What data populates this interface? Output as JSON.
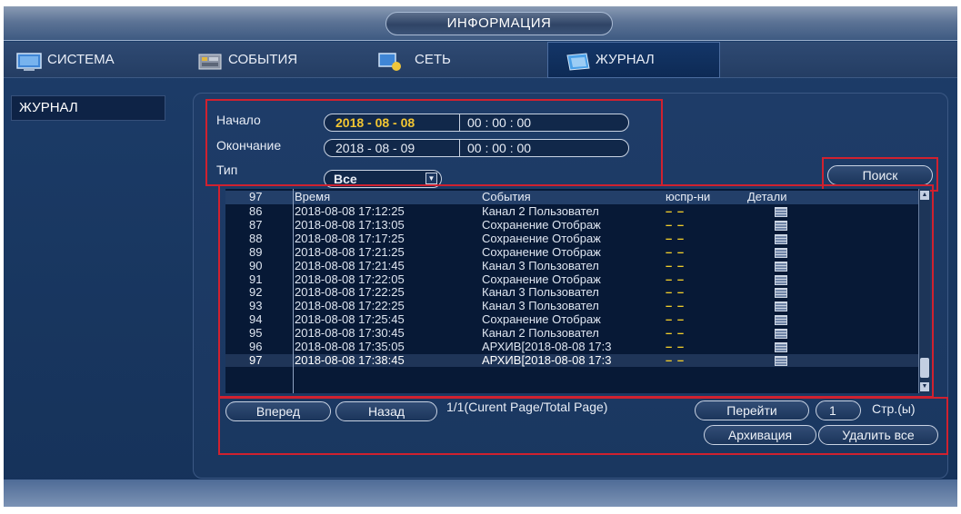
{
  "window": {
    "title": "ИНФОРМАЦИЯ"
  },
  "tabs": [
    {
      "label": "СИСТЕМА",
      "icon": "monitor-icon"
    },
    {
      "label": "СОБЫТИЯ",
      "icon": "events-icon"
    },
    {
      "label": "СЕТЬ",
      "icon": "network-icon"
    },
    {
      "label": "ЖУРНАЛ",
      "icon": "log-icon",
      "active": true
    }
  ],
  "sidebar": {
    "items": [
      {
        "label": "ЖУРНАЛ",
        "active": true
      }
    ]
  },
  "filters": {
    "start_label": "Начало",
    "start_date": "2018 - 08 - 08",
    "start_time": "00 : 00 : 00",
    "end_label": "Окончание",
    "end_date": "2018 - 08 - 09",
    "end_time": "00 : 00 : 00",
    "type_label": "Тип",
    "type_value": "Все",
    "search_label": "Поиск"
  },
  "table": {
    "columns": {
      "no": "97",
      "time": "Время",
      "event": "События",
      "playback": "юспр-ни",
      "details": "Детали"
    },
    "rows": [
      {
        "no": "86",
        "time": "2018-08-08 17:12:25",
        "event": "Канал 2 Пользовател",
        "playback": "– –"
      },
      {
        "no": "87",
        "time": "2018-08-08 17:13:05",
        "event": "Сохранение Отображ",
        "playback": "– –"
      },
      {
        "no": "88",
        "time": "2018-08-08 17:17:25",
        "event": "Сохранение Отображ",
        "playback": "– –"
      },
      {
        "no": "89",
        "time": "2018-08-08 17:21:25",
        "event": "Сохранение Отображ",
        "playback": "– –"
      },
      {
        "no": "90",
        "time": "2018-08-08 17:21:45",
        "event": "Канал 3 Пользовател",
        "playback": "– –"
      },
      {
        "no": "91",
        "time": "2018-08-08 17:22:05",
        "event": "Сохранение Отображ",
        "playback": "– –"
      },
      {
        "no": "92",
        "time": "2018-08-08 17:22:25",
        "event": "Канал 3 Пользовател",
        "playback": "– –"
      },
      {
        "no": "93",
        "time": "2018-08-08 17:22:25",
        "event": "Канал 3 Пользовател",
        "playback": "– –"
      },
      {
        "no": "94",
        "time": "2018-08-08 17:25:45",
        "event": "Сохранение Отображ",
        "playback": "– –"
      },
      {
        "no": "95",
        "time": "2018-08-08 17:30:45",
        "event": "Канал 2 Пользовател",
        "playback": "– –"
      },
      {
        "no": "96",
        "time": "2018-08-08 17:35:05",
        "event": "АРХИВ[2018-08-08 17:3",
        "playback": "– –"
      },
      {
        "no": "97",
        "time": "2018-08-08 17:38:45",
        "event": "АРХИВ[2018-08-08 17:3",
        "playback": "– –",
        "selected": true
      }
    ]
  },
  "pager": {
    "forward_label": "Вперед",
    "back_label": "Назад",
    "page_info": "1/1(Curent Page/Total Page)",
    "goto_label": "Перейти",
    "page_input": "1",
    "page_unit": "Стр.(ы)",
    "archive_label": "Архивация",
    "delete_all_label": "Удалить все"
  },
  "colors": {
    "highlight": "#d0212f",
    "date_accent": "#f2c632",
    "panel": "#1e3c68"
  }
}
